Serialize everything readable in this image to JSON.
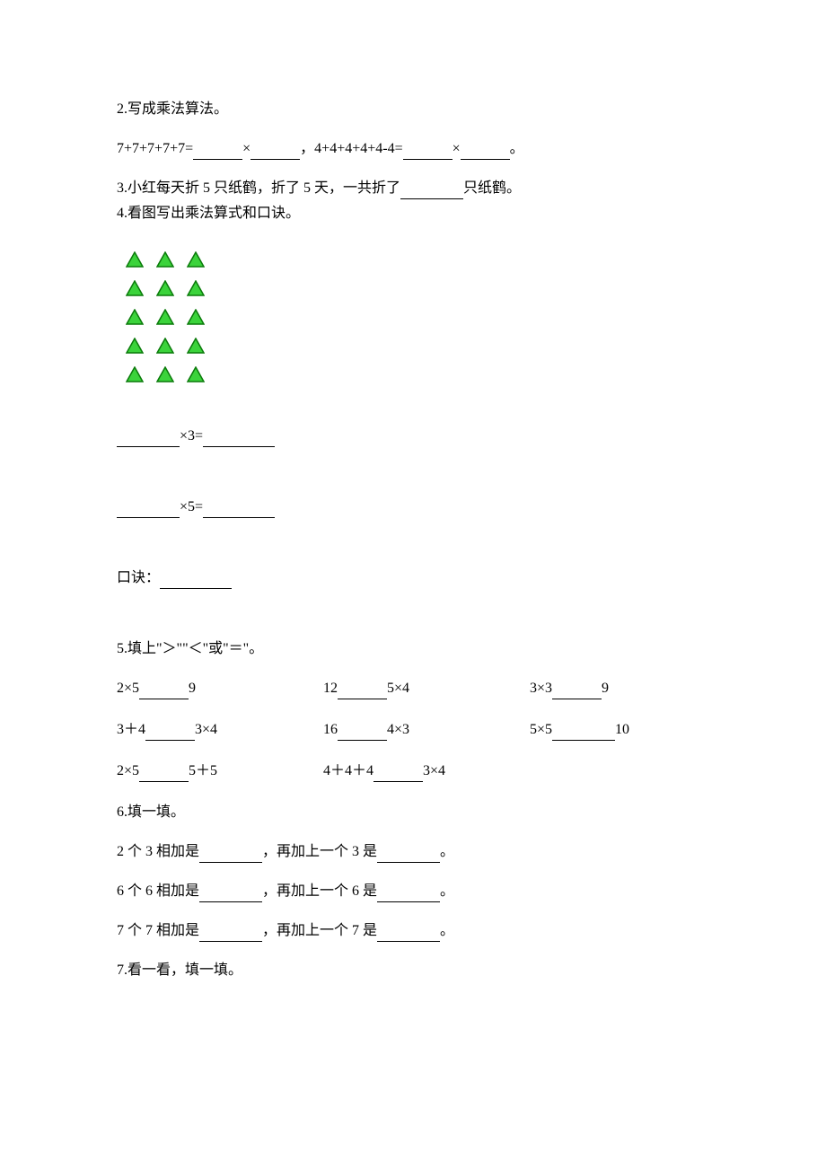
{
  "q2": {
    "title": "2.写成乘法算法。",
    "expr1_left": "7+7+7+7+7=",
    "mult": "×",
    "sep": "，",
    "expr2_left": "4+4+4+4+4-4=",
    "period": "。"
  },
  "q3": {
    "text_a": "3.小红每天折 5 只纸鹤，折了 5 天，一共折了",
    "text_b": "只纸鹤。"
  },
  "q4": {
    "title": "4.看图写出乘法算式和口诀。",
    "times3": "×3=",
    "times5": "×5=",
    "koujue_label": "口诀："
  },
  "q5": {
    "title": "5.填上\"＞\"\"＜\"或\"＝\"。",
    "rows": [
      [
        {
          "l": "2×5",
          "r": "9"
        },
        {
          "l": "12",
          "r": "5×4"
        },
        {
          "l": "3×3",
          "r": "9"
        }
      ],
      [
        {
          "l": "3＋4",
          "r": "3×4"
        },
        {
          "l": "16",
          "r": "4×3"
        },
        {
          "l": "5×5",
          "r": "10"
        }
      ],
      [
        {
          "l": "2×5",
          "r": "5＋5"
        },
        {
          "l": "4＋4＋4",
          "r": "3×4"
        },
        {
          "l": "",
          "r": ""
        }
      ]
    ]
  },
  "q6": {
    "title": "6.填一填。",
    "lines": [
      {
        "a": "2 个 3 相加是",
        "b": "，再加上一个 3 是",
        "c": "。"
      },
      {
        "a": "6 个 6 相加是",
        "b": "，再加上一个 6 是",
        "c": "。"
      },
      {
        "a": "7 个 7 相加是",
        "b": "，再加上一个 7 是",
        "c": "。"
      }
    ]
  },
  "q7": {
    "title": "7.看一看，填一填。"
  }
}
